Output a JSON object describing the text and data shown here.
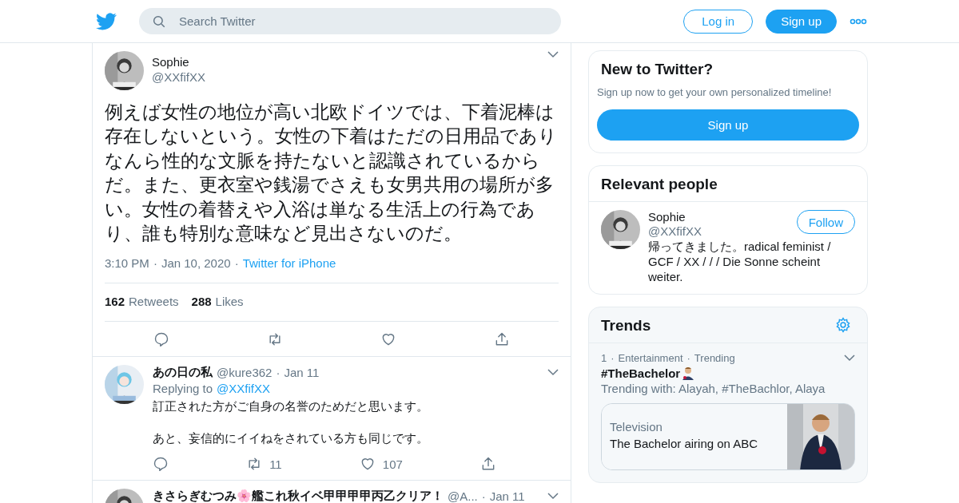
{
  "separator": "·",
  "header": {
    "search_placeholder": "Search Twitter",
    "login": "Log in",
    "signup": "Sign up"
  },
  "tweet": {
    "name": "Sophie",
    "handle": "@XXfifXX",
    "text": "例えば女性の地位が高い北欧ドイツでは、下着泥棒は存在しないという。女性の下着はただの日用品でありなんら性的な文脈を持たないと認識されているからだ。また、更衣室や銭湯でさえも女男共用の場所が多い。女性の着替えや入浴は単なる生活上の行為であり、誰も特別な意味など見出さないのだ。",
    "time": "3:10 PM",
    "date": "Jan 10, 2020",
    "source": "Twitter for iPhone",
    "retweets": "162",
    "retweets_label": "Retweets",
    "likes": "288",
    "likes_label": "Likes"
  },
  "replies": [
    {
      "name": "あの日の私",
      "handle": "@kure362",
      "date": "Jan 11",
      "replying_label": "Replying to",
      "replying_to": "@XXfifXX",
      "lines": [
        "訂正された方がご自身の名誉のためだと思います。",
        "あと、妄信的にイイねをされている方も同じです。"
      ],
      "retweets": "11",
      "likes": "107"
    },
    {
      "name": "きさらぎむつみ🌸艦これ秋イベ甲甲甲甲丙乙クリア！",
      "handle": "@A...",
      "date": "Jan 11"
    }
  ],
  "new_to_twitter": {
    "title": "New to Twitter?",
    "text": "Sign up now to get your own personalized timeline!",
    "button": "Sign up"
  },
  "relevant_people": {
    "title": "Relevant people",
    "person": {
      "name": "Sophie",
      "handle": "@XXfifXX",
      "bio": "帰ってきました。radical feminist / GCF / XX / / / Die Sonne scheint weiter.",
      "button": "Follow"
    }
  },
  "trends": {
    "title": "Trends",
    "items": [
      {
        "rank": "1",
        "category": "Entertainment",
        "status": "Trending",
        "name": "#TheBachelor",
        "with": "Trending with: Alayah, #TheBachlor, Alaya",
        "card": {
          "kind": "Television",
          "title": "The Bachelor airing on ABC"
        }
      }
    ]
  }
}
